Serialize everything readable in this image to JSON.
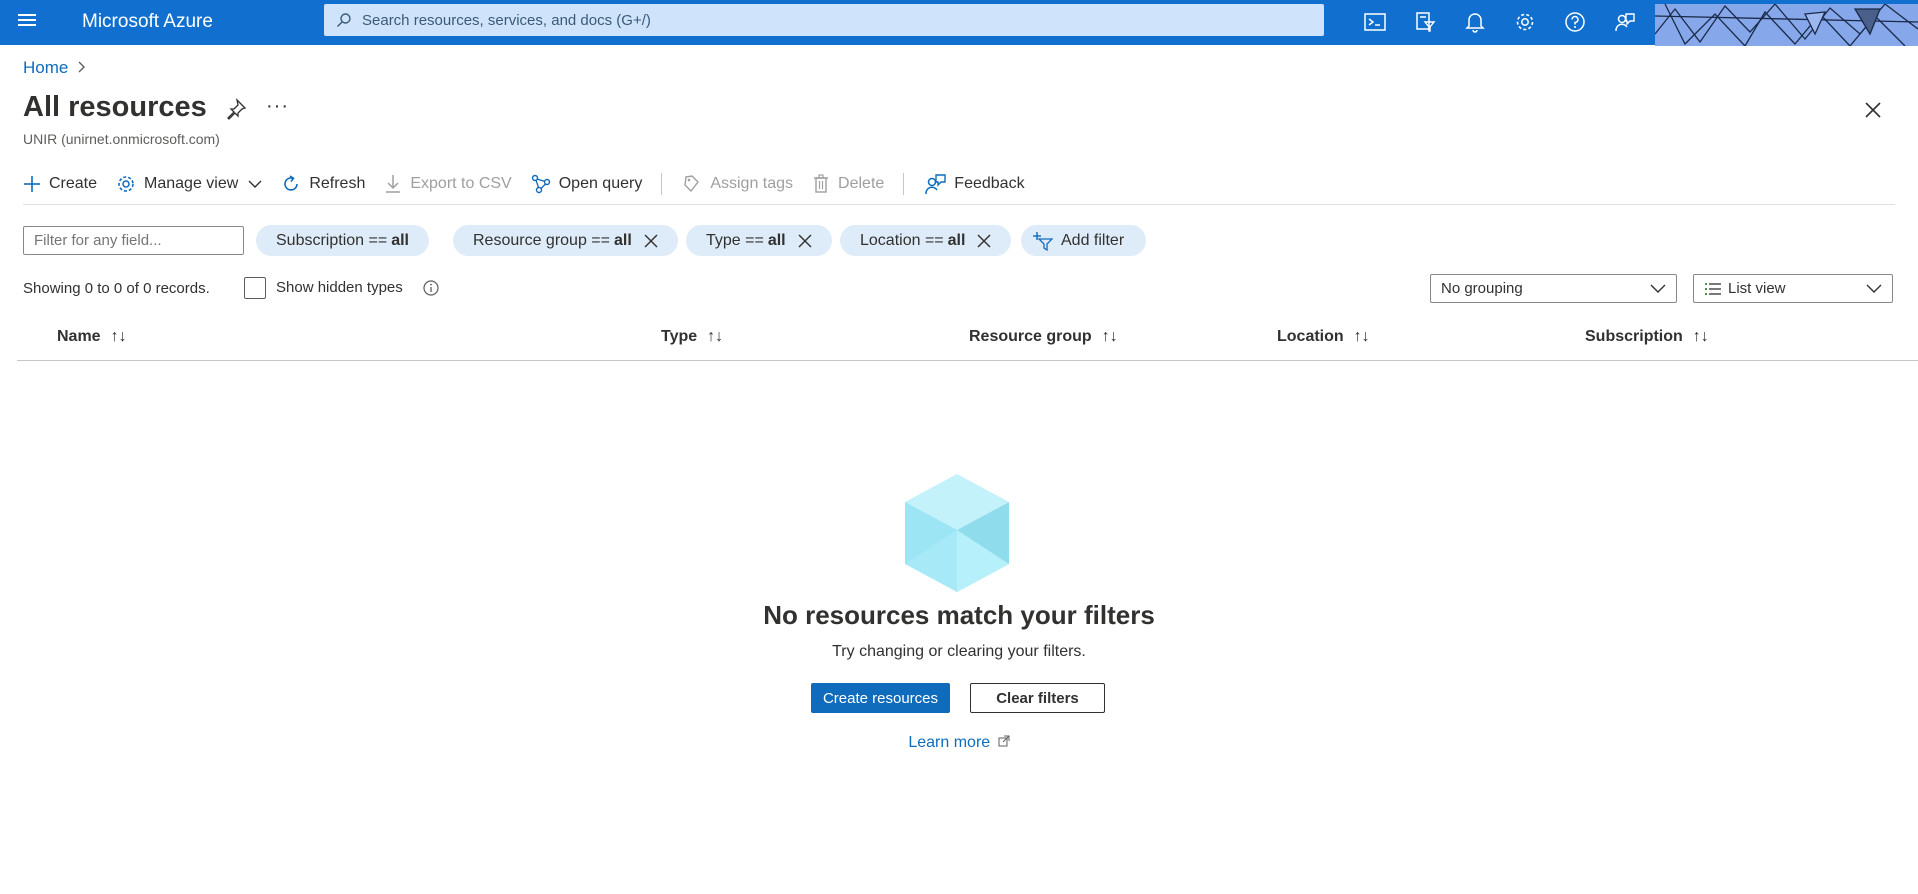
{
  "topbar": {
    "brand": "Microsoft Azure",
    "search_placeholder": "Search resources, services, and docs (G+/)",
    "icons": [
      "cloud-shell-icon",
      "directory-filter-icon",
      "notifications-icon",
      "settings-icon",
      "help-icon",
      "feedback-icon"
    ],
    "color": "#1170cf"
  },
  "breadcrumb": {
    "home": "Home",
    "separator": ">"
  },
  "page": {
    "title": "All resources",
    "more": "···",
    "subtitle": "UNIR (unirnet.onmicrosoft.com)"
  },
  "toolbar": {
    "create": "Create",
    "manage_view": "Manage view",
    "refresh": "Refresh",
    "export_csv": "Export to CSV",
    "open_query": "Open query",
    "assign_tags": "Assign tags",
    "delete": "Delete",
    "feedback": "Feedback"
  },
  "filters": {
    "placeholder": "Filter for any field...",
    "pills": [
      {
        "label": "Subscription ==",
        "value": "all"
      },
      {
        "label": "Resource group ==",
        "value": "all"
      },
      {
        "label": "Type ==",
        "value": "all"
      },
      {
        "label": "Location ==",
        "value": "all"
      }
    ],
    "add_filter": "Add filter"
  },
  "records": {
    "summary": "Showing 0 to 0 of 0 records.",
    "show_hidden": "Show hidden types",
    "grouping": "No grouping",
    "view": "List view"
  },
  "columns": [
    "Name",
    "Type",
    "Resource group",
    "Location",
    "Subscription"
  ],
  "sort_glyph": "↑↓",
  "empty": {
    "title": "No resources match your filters",
    "subtitle": "Try changing or clearing your filters.",
    "create_button": "Create resources",
    "clear_button": "Clear filters",
    "learn_more": "Learn more"
  }
}
